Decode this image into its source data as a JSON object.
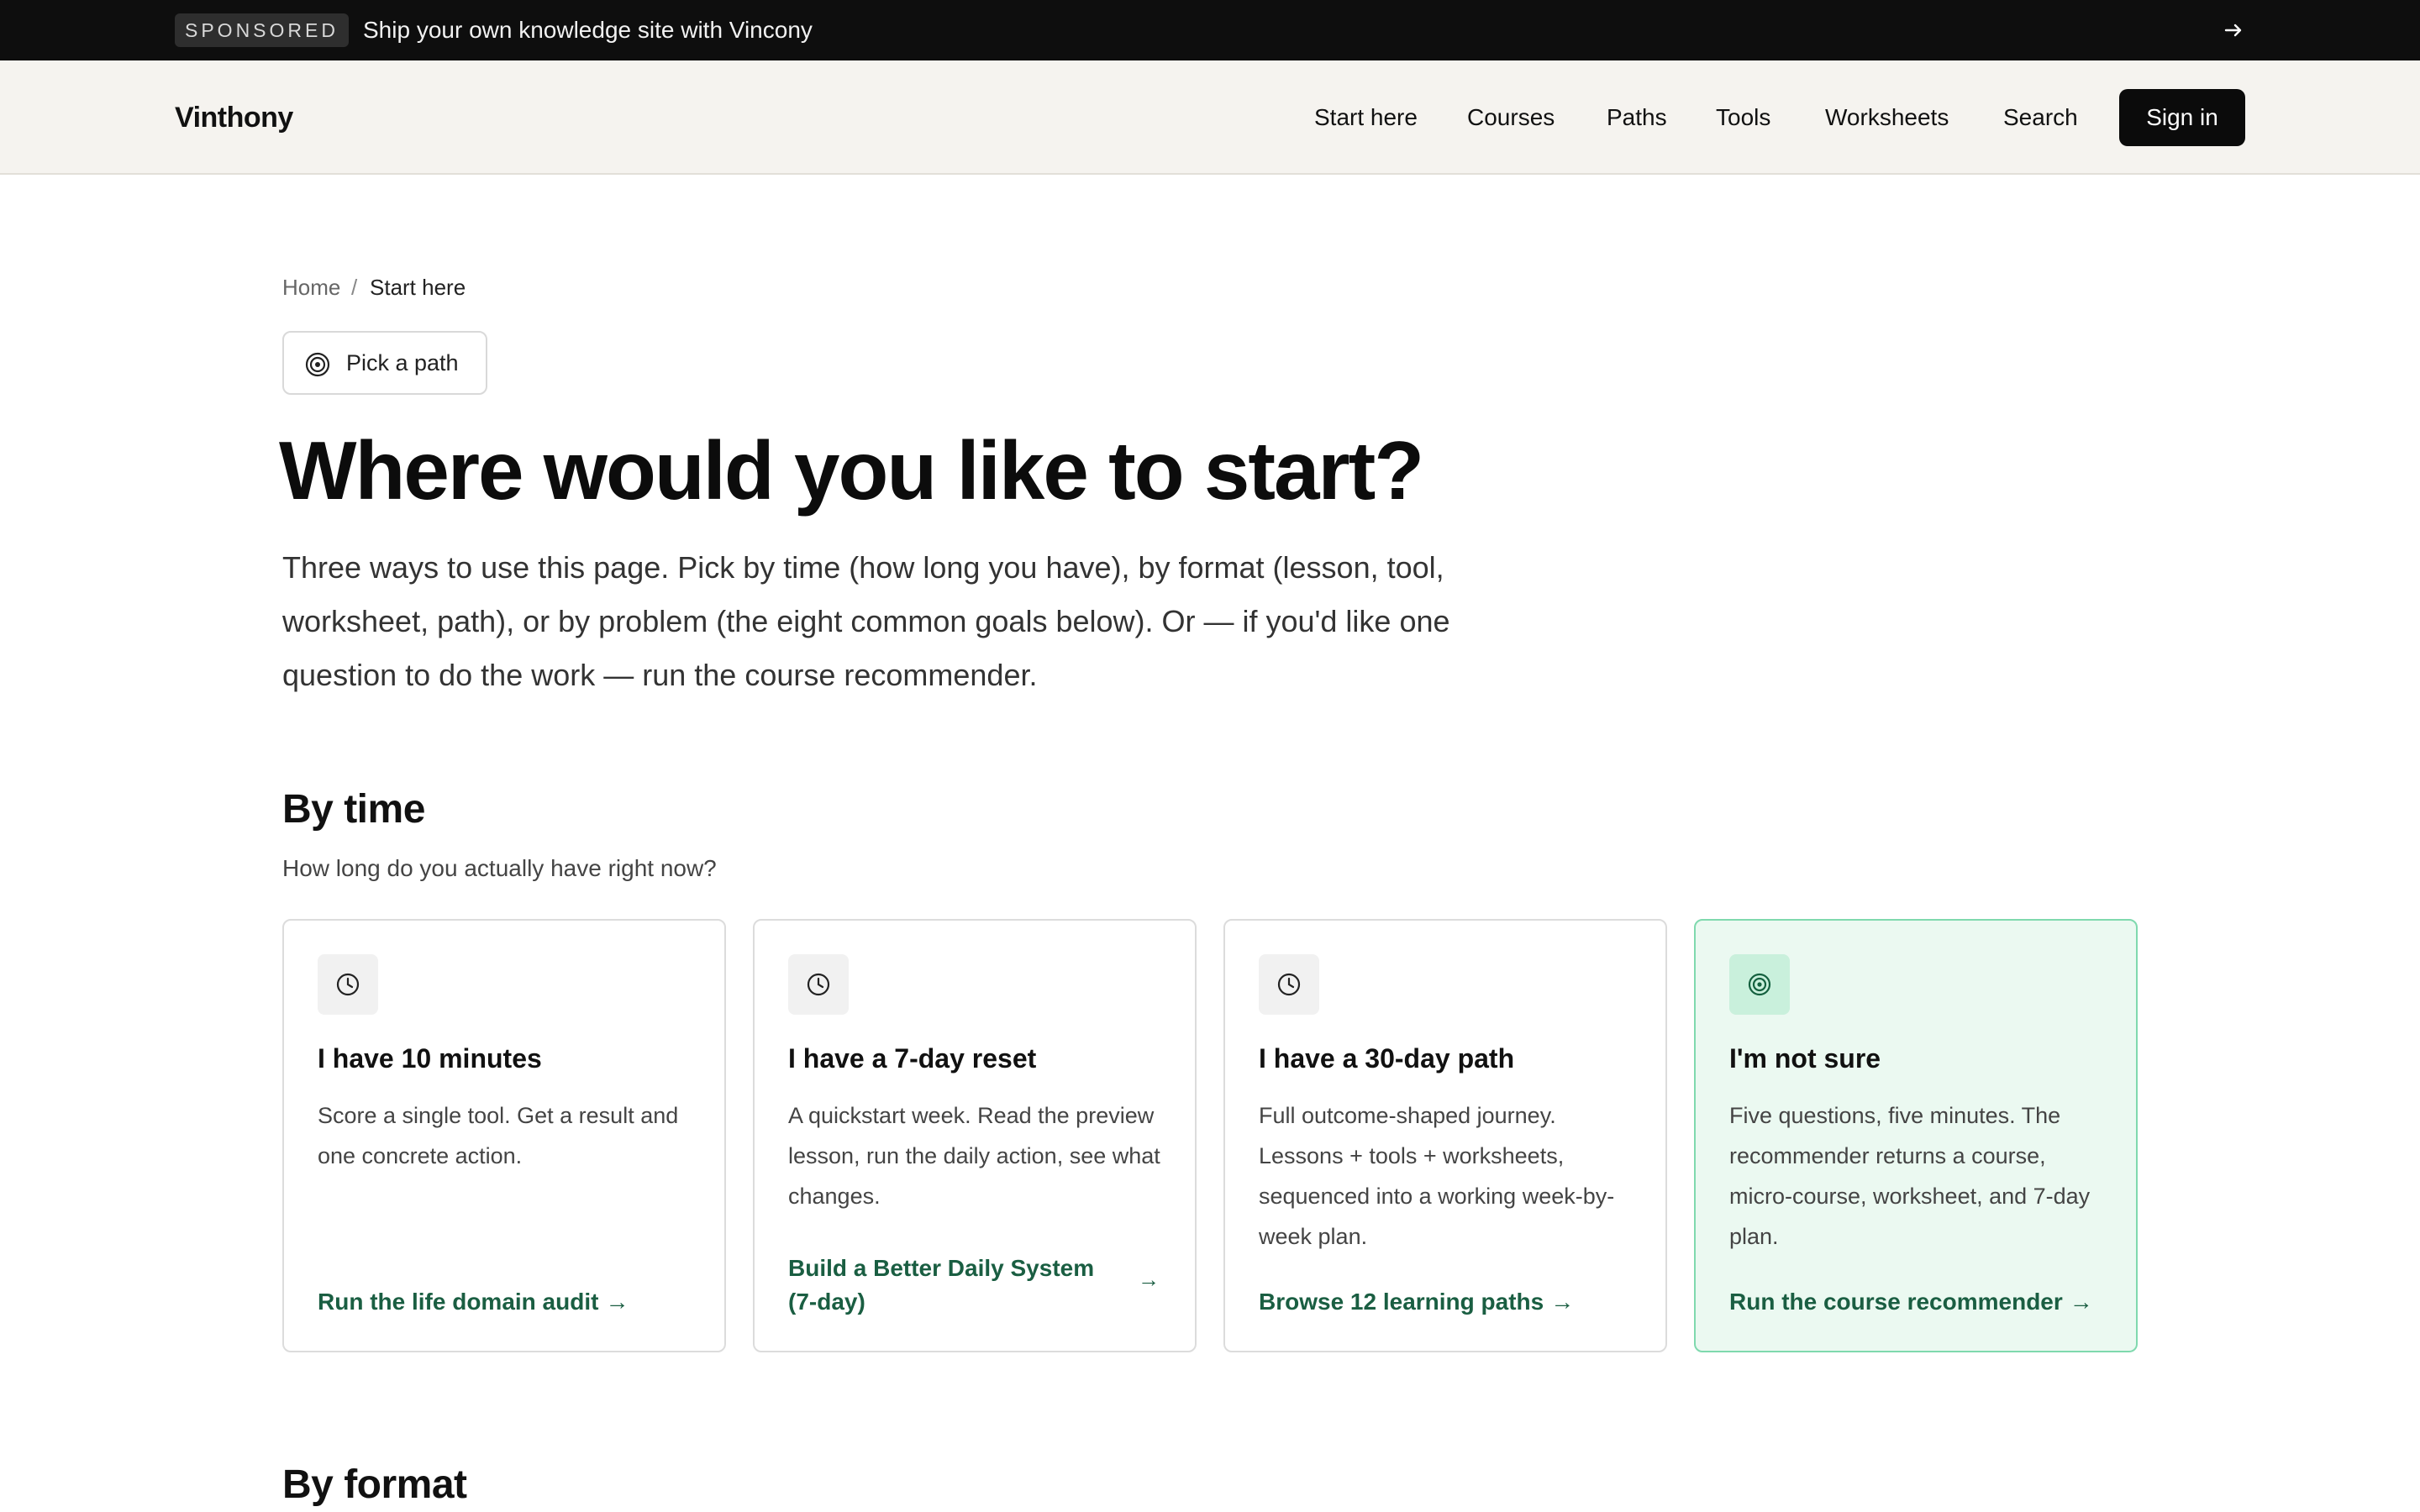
{
  "sponsor": {
    "badge": "SPONSORED",
    "text": "Ship your own knowledge site with Vincony",
    "arrow_icon": "arrow-right-icon"
  },
  "header": {
    "logo": "Vinthony",
    "nav": [
      "Start here",
      "Courses",
      "Paths",
      "Tools",
      "Worksheets",
      "Search"
    ],
    "signin_label": "Sign in"
  },
  "breadcrumb": {
    "home": "Home",
    "separator": "/",
    "current": "Start here"
  },
  "pill": {
    "label": "Pick a path",
    "icon": "target-icon"
  },
  "title": "Where would you like to start?",
  "intro": "Three ways to use this page. Pick by time (how long you have), by format (lesson, tool, worksheet, path), or by problem (the eight common goals below). Or — if you'd like one question to do the work — run the course recommender.",
  "by_time": {
    "title": "By time",
    "subtitle": "How long do you actually have right now?",
    "cards": [
      {
        "icon": "clock-icon",
        "title": "I have 10 minutes",
        "desc": "Score a single tool. Get a result and one concrete action.",
        "link": "Run the life domain audit"
      },
      {
        "icon": "clock-icon",
        "title": "I have a 7-day reset",
        "desc": "A quickstart week. Read the preview lesson, run the daily action, see what changes.",
        "link": "Build a Better Daily System (7-day)"
      },
      {
        "icon": "clock-icon",
        "title": "I have a 30-day path",
        "desc": "Full outcome-shaped journey. Lessons + tools + worksheets, sequenced into a working week-by-week plan.",
        "link": "Browse 12 learning paths"
      },
      {
        "icon": "target-icon",
        "title": "I'm not sure",
        "desc": "Five questions, five minutes. The recommender returns a course, micro-course, worksheet, and 7-day plan.",
        "link": "Run the course recommender"
      }
    ]
  },
  "by_format": {
    "title": "By format"
  },
  "colors": {
    "accent_green": "#1a5e42",
    "highlight_bg": "#ebf9f1",
    "highlight_border": "#7fd9ae",
    "header_bg": "#f5f3ef",
    "sponsor_bg": "#0e0e0e"
  }
}
